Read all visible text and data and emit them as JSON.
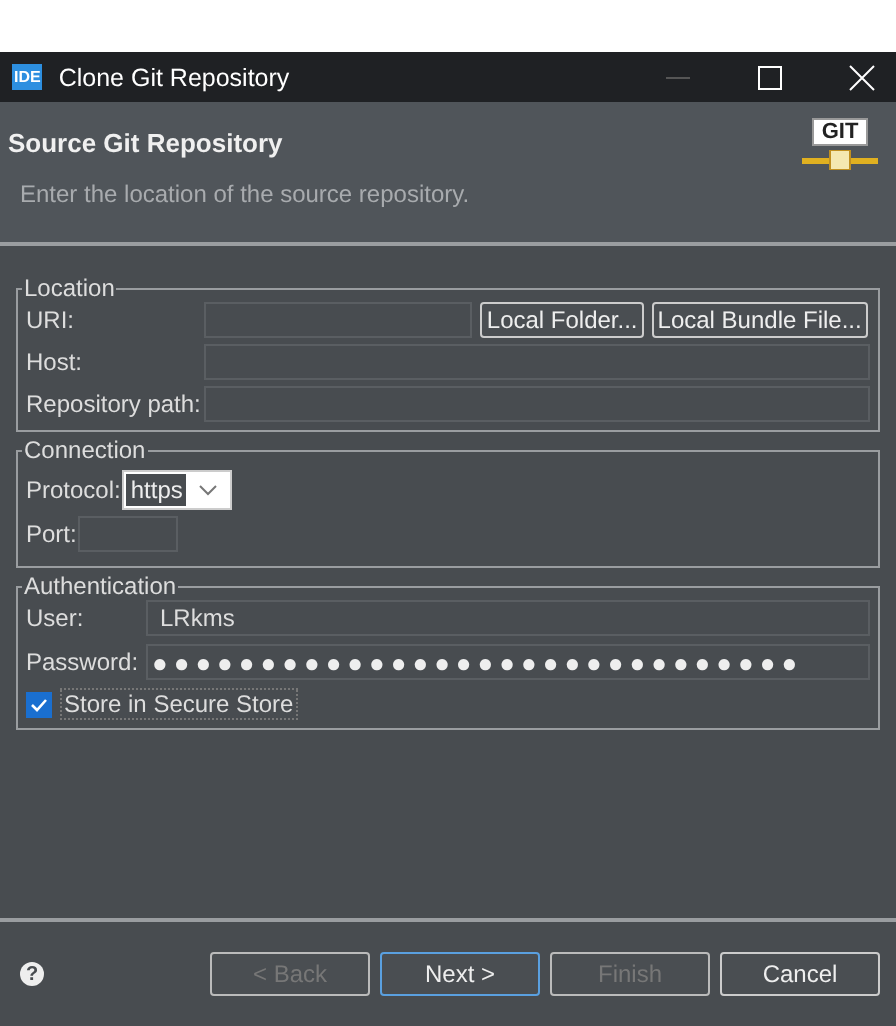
{
  "window": {
    "title": "Clone Git Repository",
    "icon_text": "IDE"
  },
  "header": {
    "title": "Source Git Repository",
    "description": "Enter the location of the source repository.",
    "logo_text": "GIT"
  },
  "location": {
    "legend": "Location",
    "fields": [
      {
        "label": "URI:"
      },
      {
        "label": "Host:"
      },
      {
        "label": "Repository path:"
      }
    ],
    "buttons": [
      "Local Folder...",
      "Local Bundle File..."
    ]
  },
  "connection": {
    "legend": "Connection",
    "protocol": {
      "label": "Protocol:",
      "value": "https"
    },
    "port": {
      "label": "Port:"
    }
  },
  "authentication": {
    "legend": "Authentication",
    "user": {
      "label": "User:",
      "value": "LRkms"
    },
    "password": {
      "label": "Password:",
      "value": "●●●●●●●●●●●●●●●●●●●●●●●●●●●●●●"
    },
    "store": {
      "label": "Store in Secure Store",
      "checked": true
    }
  },
  "footer": {
    "help": "?",
    "buttons": [
      {
        "label": "< Back",
        "disabled": true,
        "focused": false
      },
      {
        "label": "Next >",
        "disabled": false,
        "focused": true
      },
      {
        "label": "Finish",
        "disabled": true,
        "focused": false
      },
      {
        "label": "Cancel",
        "disabled": false,
        "focused": false
      }
    ]
  }
}
